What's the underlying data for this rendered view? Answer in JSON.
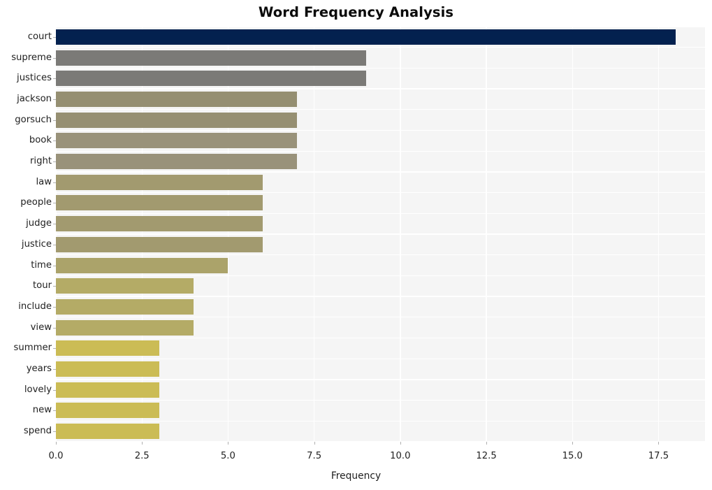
{
  "chart_data": {
    "type": "bar",
    "orientation": "horizontal",
    "title": "Word Frequency Analysis",
    "xlabel": "Frequency",
    "ylabel": "",
    "categories": [
      "court",
      "supreme",
      "justices",
      "jackson",
      "gorsuch",
      "book",
      "right",
      "law",
      "people",
      "judge",
      "justice",
      "time",
      "tour",
      "include",
      "view",
      "summer",
      "years",
      "lovely",
      "new",
      "spend"
    ],
    "values": [
      18,
      9,
      9,
      7,
      7,
      7,
      7,
      6,
      6,
      6,
      6,
      5,
      4,
      4,
      4,
      3,
      3,
      3,
      3,
      3
    ],
    "bar_colors": [
      "#03214f",
      "#7b7a77",
      "#7b7a77",
      "#958f72",
      "#968f72",
      "#99927a",
      "#99927a",
      "#a29a6f",
      "#a29a6f",
      "#a29a6f",
      "#a29a6f",
      "#aba36a",
      "#b4ab66",
      "#b4ab66",
      "#b4ab66",
      "#cbbc55",
      "#cbbc55",
      "#cbbc55",
      "#cbbc55",
      "#cbbc55"
    ],
    "xlim": [
      0,
      18.85
    ],
    "xticks": [
      "0.0",
      "2.5",
      "5.0",
      "7.5",
      "10.0",
      "12.5",
      "15.0",
      "17.5"
    ],
    "xtick_values": [
      0,
      2.5,
      5,
      7.5,
      10,
      12.5,
      15,
      17.5
    ],
    "grid": true,
    "grid_color": "#ffffff",
    "plot_background": "#f5f5f5",
    "figure_background": "#ffffff",
    "legend": null,
    "legend_position": "none"
  }
}
